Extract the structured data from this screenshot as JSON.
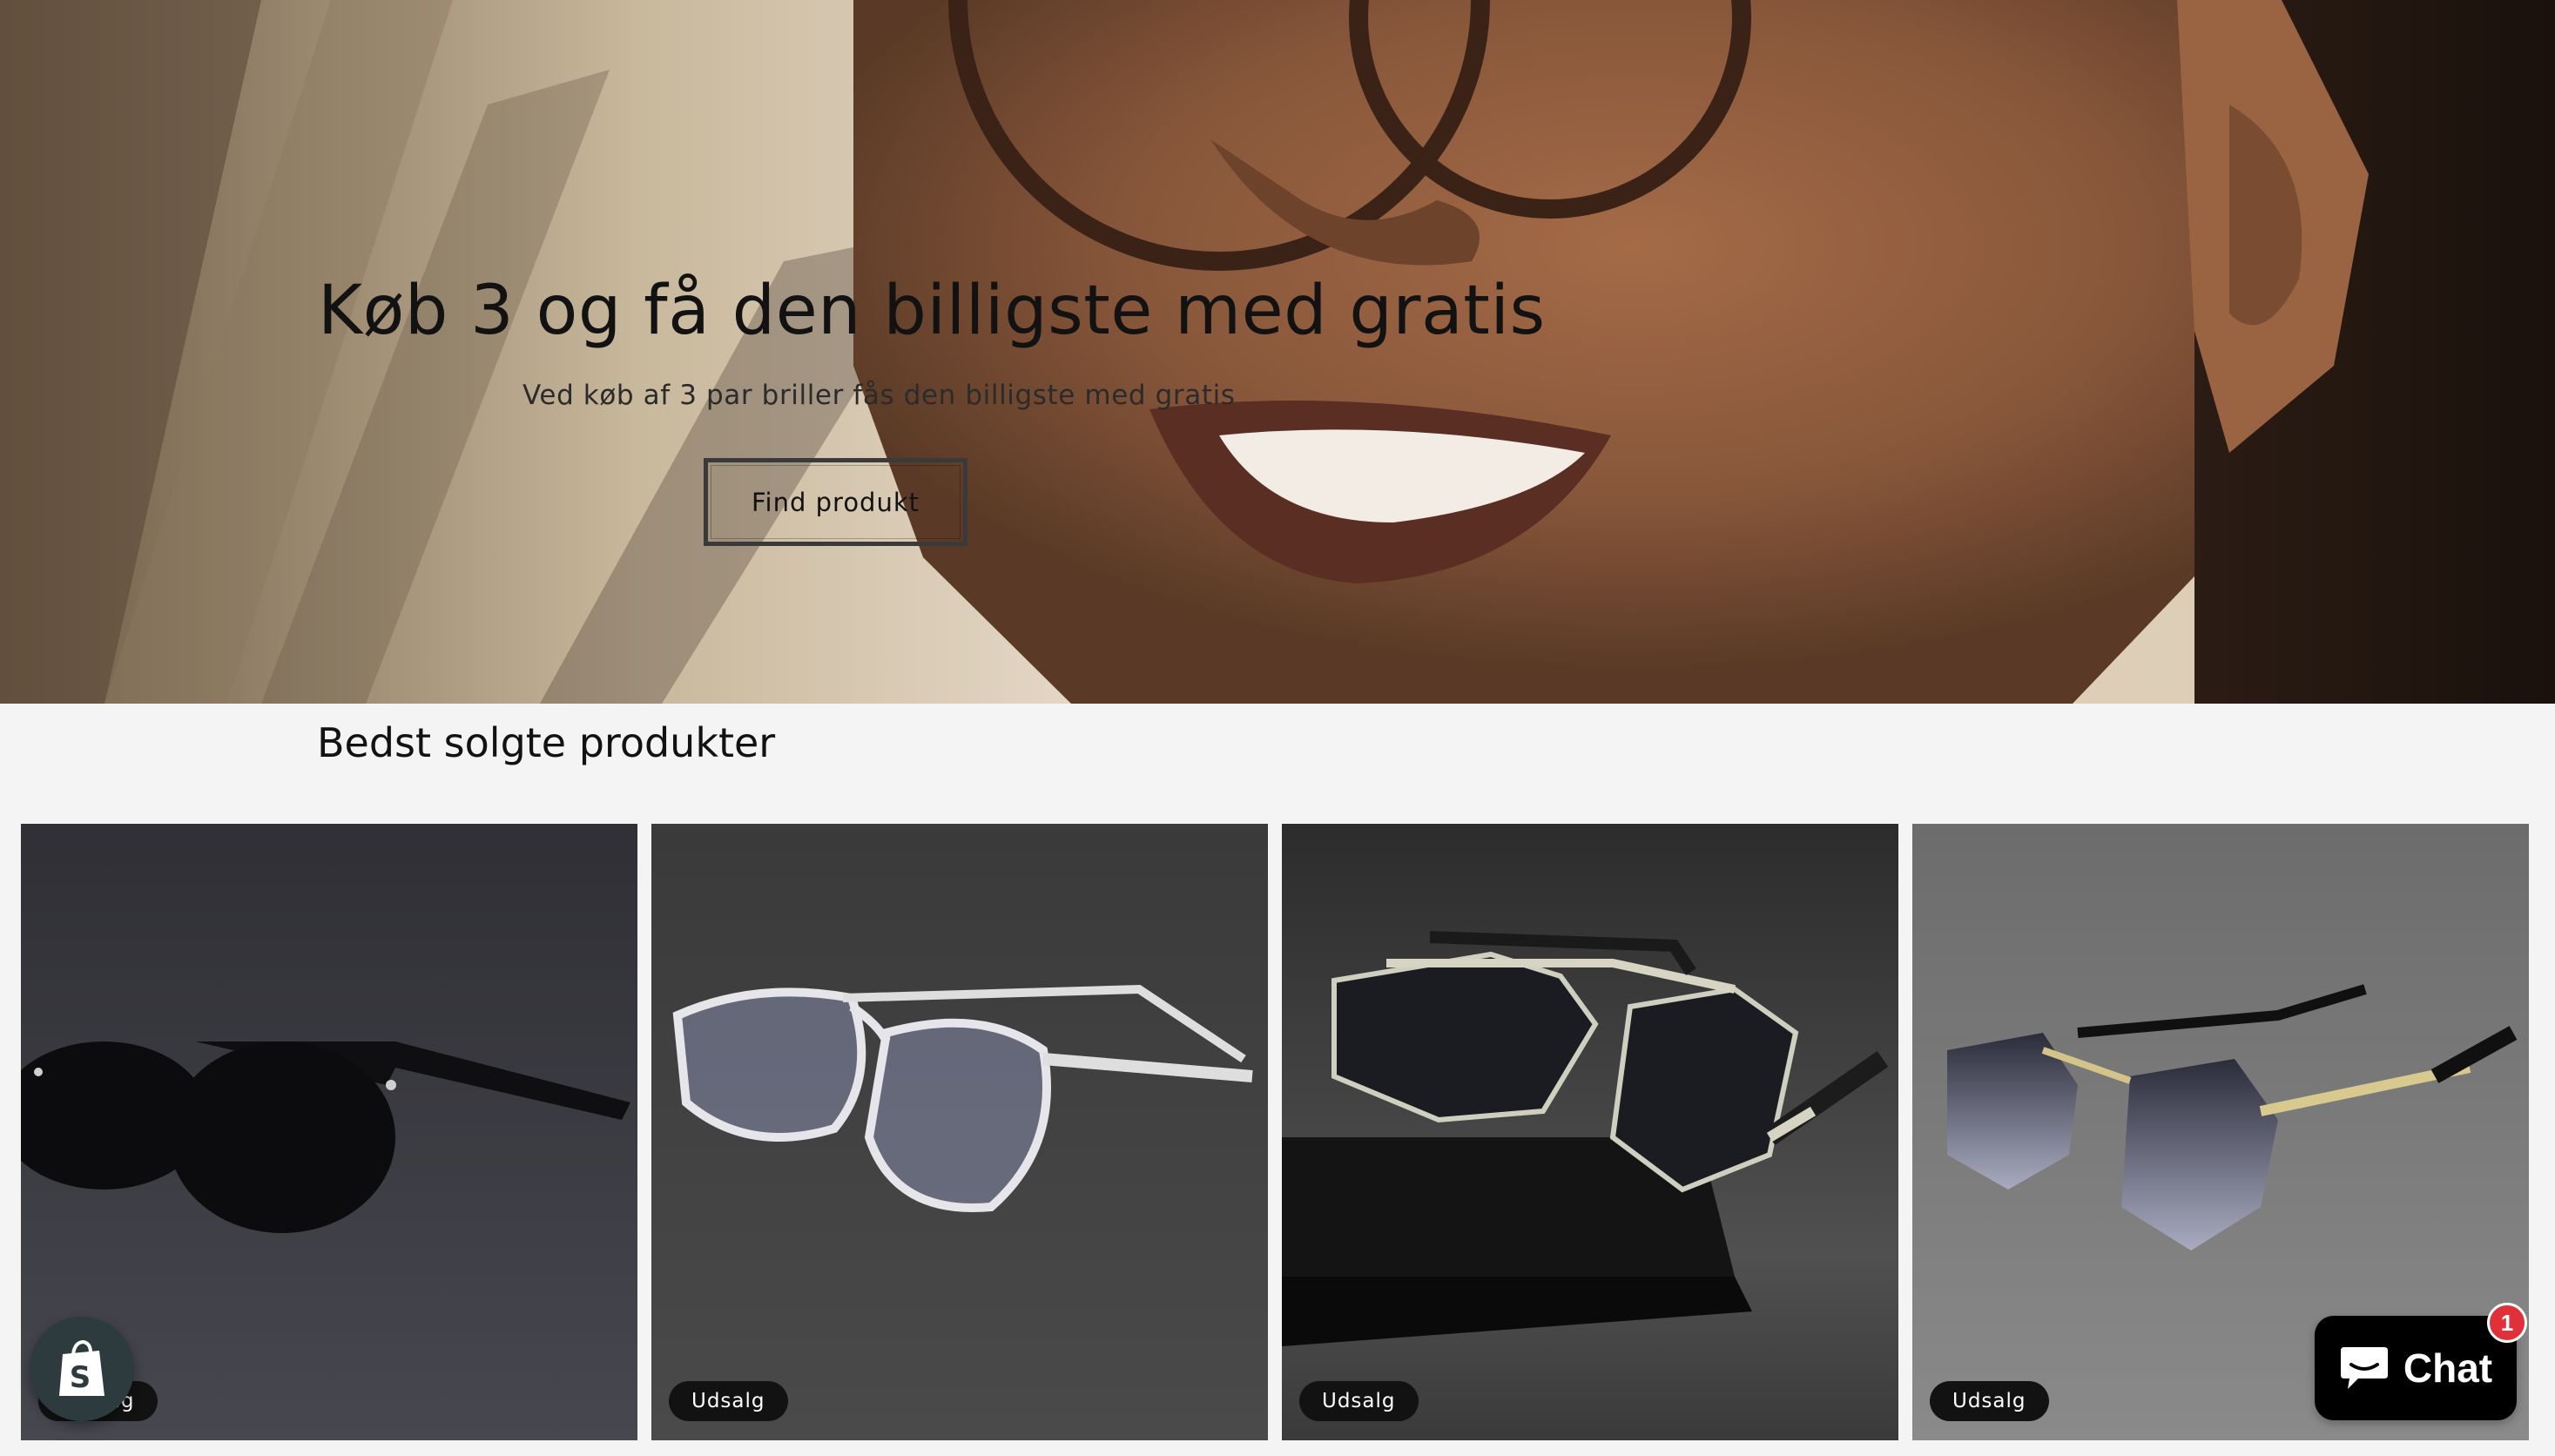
{
  "hero": {
    "title": "Køb 3 og få den billigste med gratis",
    "subtitle": "Ved køb af 3 par briller fås den billigste med gratis",
    "button_label": "Find produkt",
    "image_icon": "smiling-man-glasses-photo"
  },
  "bestsellers": {
    "title": "Bedst solgte produkter",
    "products": [
      {
        "image_icon": "black-sunglasses-photo",
        "badge": "Udsalg"
      },
      {
        "image_icon": "clear-frame-glasses-photo",
        "badge": "Udsalg"
      },
      {
        "image_icon": "aviator-sunglasses-photo",
        "badge": "Udsalg"
      },
      {
        "image_icon": "rimless-gradient-sunglasses-photo",
        "badge": "Udsalg"
      }
    ]
  },
  "shopify": {
    "icon": "shopify-bag-icon"
  },
  "chat": {
    "label": "Chat",
    "unread_count": "1",
    "icon": "chat-bubble-icon"
  },
  "colors": {
    "background": "#f4f4f4",
    "text": "#121212",
    "badge_bg": "#121212",
    "chat_bg": "#000000",
    "notification": "#e0303a"
  }
}
